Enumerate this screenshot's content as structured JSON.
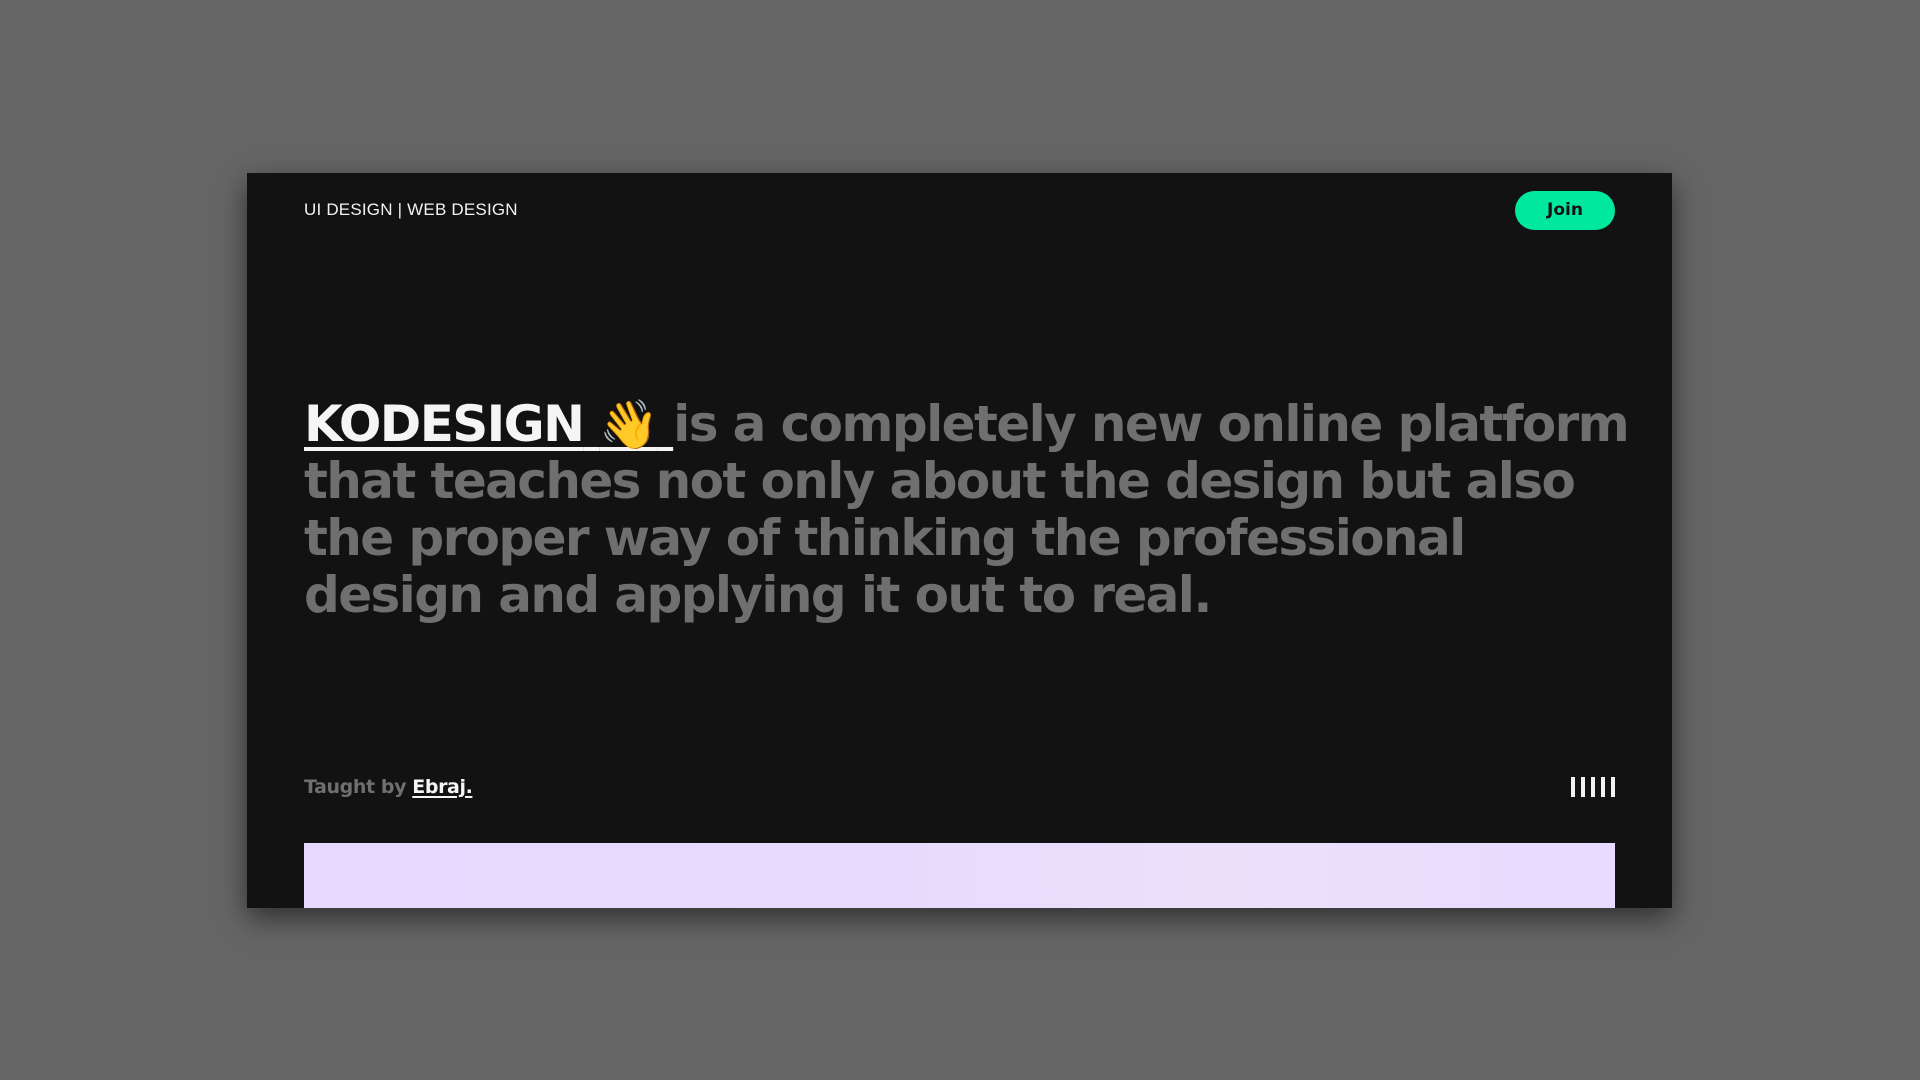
{
  "nav": {
    "title": "UI DESIGN | WEB DESIGN",
    "join_label": "Join"
  },
  "hero": {
    "brand": "KODESIGN",
    "wave_emoji": "👋",
    "text": "is a completely new online platform that teaches not only about the design but also the proper way of thinking the professional design and applying it out to real."
  },
  "footer": {
    "taught_prefix": "Taught by",
    "author": "Ebraj."
  },
  "icons": {
    "wave": "waving-hand-icon",
    "menu": "vertical-bars-icon"
  },
  "colors": {
    "page_background": "#666666",
    "frame_background": "#121212",
    "accent": "#00e89d",
    "muted_text": "#6f6f6f",
    "bright_text": "#f5f5f5",
    "panel": "#e7dbff"
  }
}
